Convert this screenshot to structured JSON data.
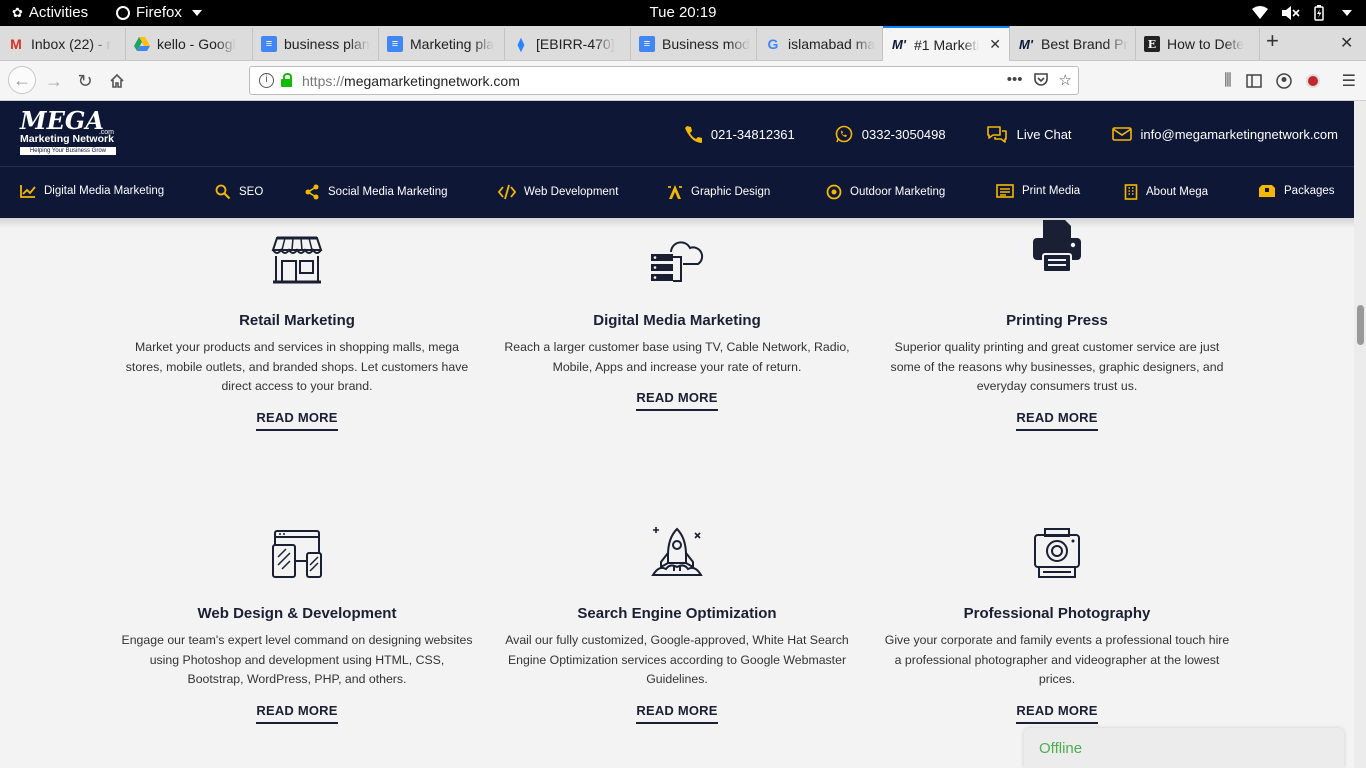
{
  "system": {
    "activities": "Activities",
    "app_name": "Firefox",
    "clock": "Tue 20:19"
  },
  "browser": {
    "tabs": [
      {
        "title": "Inbox (22) - r",
        "favicon": "gmail-icon",
        "color": "#d93025"
      },
      {
        "title": "kello - Googl",
        "favicon": "google-drive-icon",
        "color": "#1fa463"
      },
      {
        "title": "business plan",
        "favicon": "google-docs-icon",
        "color": "#4285f4"
      },
      {
        "title": "Marketing pla",
        "favicon": "google-docs-icon",
        "color": "#4285f4"
      },
      {
        "title": "[EBIRR-470] ",
        "favicon": "jira-icon",
        "color": "#2684ff"
      },
      {
        "title": "Business mod",
        "favicon": "google-docs-icon",
        "color": "#4285f4"
      },
      {
        "title": "islamabad ma",
        "favicon": "google-icon",
        "color": "#4285f4"
      },
      {
        "title": "#1 Marketi",
        "favicon": "mega-icon",
        "color": "#0e1736",
        "active": true
      },
      {
        "title": "Best Brand Pr",
        "favicon": "mega-icon",
        "color": "#0e1736"
      },
      {
        "title": "How to Dete",
        "favicon": "entrepreneur-icon",
        "color": "#222222"
      }
    ],
    "url_scheme": "https://",
    "url_host": "megamarketingnetwork.com"
  },
  "site": {
    "logo": {
      "mega": "MEGA",
      "network": "Marketing Network",
      "com": ".com",
      "tagline": "Helping Your Business Grow"
    },
    "contacts": {
      "phone": "021-34812361",
      "whatsapp": "0332-3050498",
      "chat": "Live Chat",
      "email": "info@megamarketingnetwork.com"
    },
    "nav": [
      "Digital Media Marketing",
      "SEO",
      "Social Media Marketing",
      "Web Development",
      "Graphic Design",
      "Outdoor Marketing",
      "Print Media",
      "About Mega",
      "Packages"
    ],
    "accent": "#f5b800",
    "navy": "#0e1736"
  },
  "services": [
    {
      "title": "Retail Marketing",
      "desc": "Market your products and services in shopping malls, mega stores, mobile outlets, and branded shops. Let customers have direct access to your brand.",
      "cta": "READ MORE"
    },
    {
      "title": "Digital Media Marketing",
      "desc": "Reach a larger customer base using TV, Cable Network, Radio, Mobile, Apps and increase your rate of return.",
      "cta": "READ MORE"
    },
    {
      "title": "Printing Press",
      "desc": "Superior quality printing and great customer service are just some of the reasons why businesses, graphic designers, and everyday consumers trust us.",
      "cta": "READ MORE"
    },
    {
      "title": "Web Design & Development",
      "desc": "Engage our team's expert level command on designing websites using Photoshop and development using HTML, CSS, Bootstrap, WordPress, PHP, and others.",
      "cta": "READ MORE"
    },
    {
      "title": "Search Engine Optimization",
      "desc": "Avail our fully customized, Google-approved, White Hat Search Engine Optimization services according to Google Webmaster Guidelines.",
      "cta": "READ MORE"
    },
    {
      "title": "Professional Photography",
      "desc": "Give your corporate and family events a professional touch hire a professional photographer and videographer at the lowest prices.",
      "cta": "READ MORE"
    }
  ],
  "chat_widget": {
    "status": "Offline"
  }
}
